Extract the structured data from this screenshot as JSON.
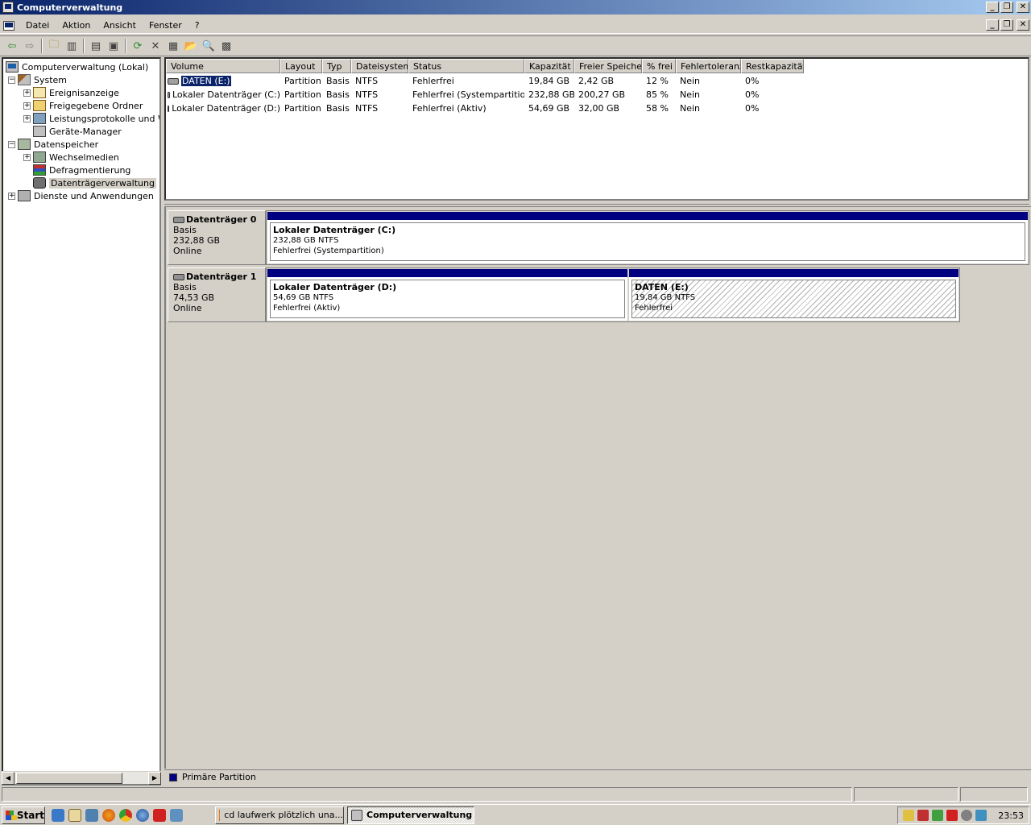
{
  "window": {
    "title": "Computerverwaltung"
  },
  "menu": [
    "Datei",
    "Aktion",
    "Ansicht",
    "Fenster",
    "?"
  ],
  "toolbar_icons": [
    "back-arrow-icon",
    "forward-arrow-icon",
    "up-folder-icon",
    "show-hide-tree-icon",
    "properties-icon",
    "help-icon",
    "refresh-icon",
    "delete-icon",
    "disk-properties-icon",
    "open-icon",
    "search-icon",
    "settings-icon"
  ],
  "tree": {
    "root": "Computerverwaltung (Lokal)",
    "system": "System",
    "eventviewer": "Ereignisanzeige",
    "shared": "Freigegebene Ordner",
    "perf": "Leistungsprotokolle und Warnungen",
    "devices": "Geräte-Manager",
    "storage": "Datenspeicher",
    "removable": "Wechselmedien",
    "defrag": "Defragmentierung",
    "diskmgmt": "Datenträgerverwaltung",
    "services": "Dienste und Anwendungen"
  },
  "volumes": {
    "columns": [
      "Volume",
      "Layout",
      "Typ",
      "Dateisystem",
      "Status",
      "Kapazität",
      "Freier Speicher",
      "% frei",
      "Fehlertoleranz",
      "Restkapazität"
    ],
    "rows": [
      {
        "name": "DATEN (E:)",
        "layout": "Partition",
        "type": "Basis",
        "fs": "NTFS",
        "status": "Fehlerfrei",
        "capacity": "19,84 GB",
        "free": "2,42 GB",
        "pct": "12 %",
        "fault": "Nein",
        "overhead": "0%"
      },
      {
        "name": "Lokaler Datenträger (C:)",
        "layout": "Partition",
        "type": "Basis",
        "fs": "NTFS",
        "status": "Fehlerfrei (Systempartition)",
        "capacity": "232,88 GB",
        "free": "200,27 GB",
        "pct": "85 %",
        "fault": "Nein",
        "overhead": "0%"
      },
      {
        "name": "Lokaler Datenträger (D:)",
        "layout": "Partition",
        "type": "Basis",
        "fs": "NTFS",
        "status": "Fehlerfrei (Aktiv)",
        "capacity": "54,69 GB",
        "free": "32,00 GB",
        "pct": "58 %",
        "fault": "Nein",
        "overhead": "0%"
      }
    ]
  },
  "disks": [
    {
      "name": "Datenträger 0",
      "kind": "Basis",
      "size": "232,88 GB",
      "state": "Online",
      "partitions": [
        {
          "title": "Lokaler Datenträger  (C:)",
          "size": "232,88 GB NTFS",
          "status": "Fehlerfrei (Systempartition)"
        }
      ]
    },
    {
      "name": "Datenträger 1",
      "kind": "Basis",
      "size": "74,53 GB",
      "state": "Online",
      "partitions": [
        {
          "title": "Lokaler Datenträger  (D:)",
          "size": "54,69 GB NTFS",
          "status": "Fehlerfrei (Aktiv)"
        },
        {
          "title": "DATEN  (E:)",
          "size": "19,84 GB NTFS",
          "status": "Fehlerfrei"
        }
      ]
    }
  ],
  "legend": {
    "label": "Primäre Partition",
    "color": "#000080"
  },
  "taskbar": {
    "start": "Start",
    "tasks": [
      "cd laufwerk plötzlich una...",
      "Computerverwaltung"
    ],
    "clock": "23:53"
  }
}
